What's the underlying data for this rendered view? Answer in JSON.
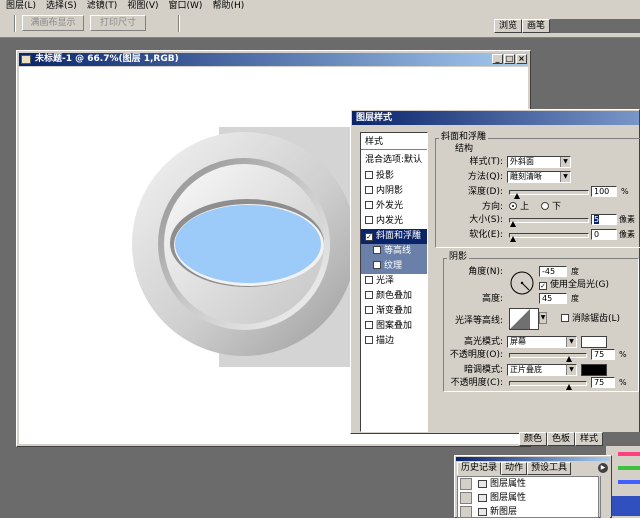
{
  "menubar": [
    "图层(L)",
    "选择(S)",
    "滤镜(T)",
    "视图(V)",
    "窗口(W)",
    "帮助(H)"
  ],
  "options_bar": {
    "fill_screen": "满画布显示",
    "print_size": "打印尺寸"
  },
  "palette_tabs": [
    "浏览",
    "画笔"
  ],
  "document": {
    "title": "未标题-1 @ 66.7%(图层 1,RGB)",
    "minimize": "_",
    "maximize": "□",
    "close": "×"
  },
  "dialog": {
    "title": "图层样式",
    "styles_header": "样式",
    "blend_options": "混合选项:默认",
    "style_items": [
      {
        "label": "投影",
        "checked": false
      },
      {
        "label": "内阴影",
        "checked": false
      },
      {
        "label": "外发光",
        "checked": false
      },
      {
        "label": "内发光",
        "checked": false
      },
      {
        "label": "斜面和浮雕",
        "checked": true
      },
      {
        "label": "等高线",
        "checked": false
      },
      {
        "label": "纹理",
        "checked": false
      },
      {
        "label": "光泽",
        "checked": false
      },
      {
        "label": "颜色叠加",
        "checked": false
      },
      {
        "label": "渐变叠加",
        "checked": false
      },
      {
        "label": "图案叠加",
        "checked": false
      },
      {
        "label": "描边",
        "checked": false
      }
    ],
    "bevel": {
      "section_title": "斜面和浮雕",
      "structure_title": "结构",
      "style_label": "样式(T):",
      "style_value": "外斜面",
      "technique_label": "方法(Q):",
      "technique_value": "雕刻清晰",
      "depth_label": "深度(D):",
      "depth_value": "100",
      "depth_unit": "%",
      "direction_label": "方向:",
      "direction_up": "上",
      "direction_down": "下",
      "size_label": "大小(S):",
      "size_value": "5",
      "size_unit": "像素",
      "soften_label": "软化(E):",
      "soften_value": "0",
      "soften_unit": "像素"
    },
    "shading": {
      "title": "阴影",
      "angle_label": "角度(N):",
      "angle_value": "-45",
      "angle_unit": "度",
      "global_light": "使用全局光(G)",
      "altitude_label": "高度:",
      "altitude_value": "45",
      "altitude_unit": "度",
      "gloss_label": "光泽等高线:",
      "antialias": "消除锯齿(L)",
      "highlight_label": "高光模式:",
      "highlight_mode": "屏幕",
      "highlight_color": "#ffffff",
      "hl_opacity_label": "不透明度(O):",
      "hl_opacity_value": "75",
      "shadow_label": "暗调模式:",
      "shadow_mode": "正片叠底",
      "shadow_color": "#000000",
      "sh_opacity_label": "不透明度(C):",
      "sh_opacity_value": "75",
      "pct": "%"
    }
  },
  "bottom_tabs": [
    "颜色",
    "色板",
    "样式"
  ],
  "history": {
    "tabs": [
      "历史记录",
      "动作",
      "预设工具"
    ],
    "items": [
      "图层属性",
      "图层属性",
      "新图层"
    ]
  }
}
